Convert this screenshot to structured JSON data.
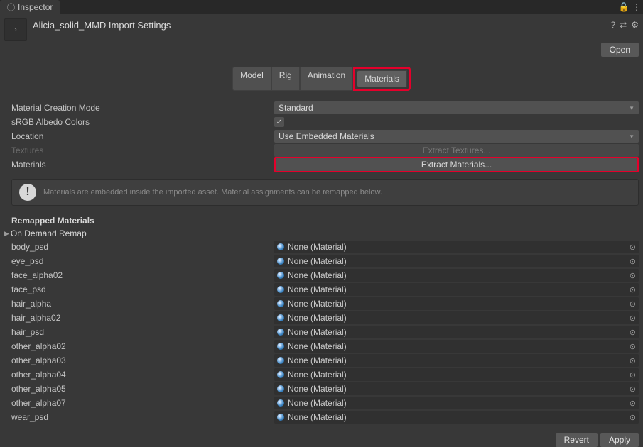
{
  "tab": {
    "title": "Inspector"
  },
  "header": {
    "title": "Alicia_solid_MMD Import Settings",
    "open_label": "Open"
  },
  "subtabs": {
    "model": "Model",
    "rig": "Rig",
    "animation": "Animation",
    "materials": "Materials"
  },
  "props": {
    "material_creation_mode": {
      "label": "Material Creation Mode",
      "value": "Standard"
    },
    "srgb_albedo": {
      "label": "sRGB Albedo Colors",
      "checked": true
    },
    "location": {
      "label": "Location",
      "value": "Use Embedded Materials"
    },
    "textures": {
      "label": "Textures",
      "button": "Extract Textures..."
    },
    "materials": {
      "label": "Materials",
      "button": "Extract Materials..."
    }
  },
  "info": {
    "text": "Materials are embedded inside the imported asset. Material assignments can be remapped below."
  },
  "remapped": {
    "heading": "Remapped Materials",
    "ondemand": "On Demand Remap",
    "none_material": "None (Material)",
    "items": [
      "body_psd",
      "eye_psd",
      "face_alpha02",
      "face_psd",
      "hair_alpha",
      "hair_alpha02",
      "hair_psd",
      "other_alpha02",
      "other_alpha03",
      "other_alpha04",
      "other_alpha05",
      "other_alpha07",
      "wear_psd"
    ]
  },
  "footer": {
    "revert": "Revert",
    "apply": "Apply"
  }
}
